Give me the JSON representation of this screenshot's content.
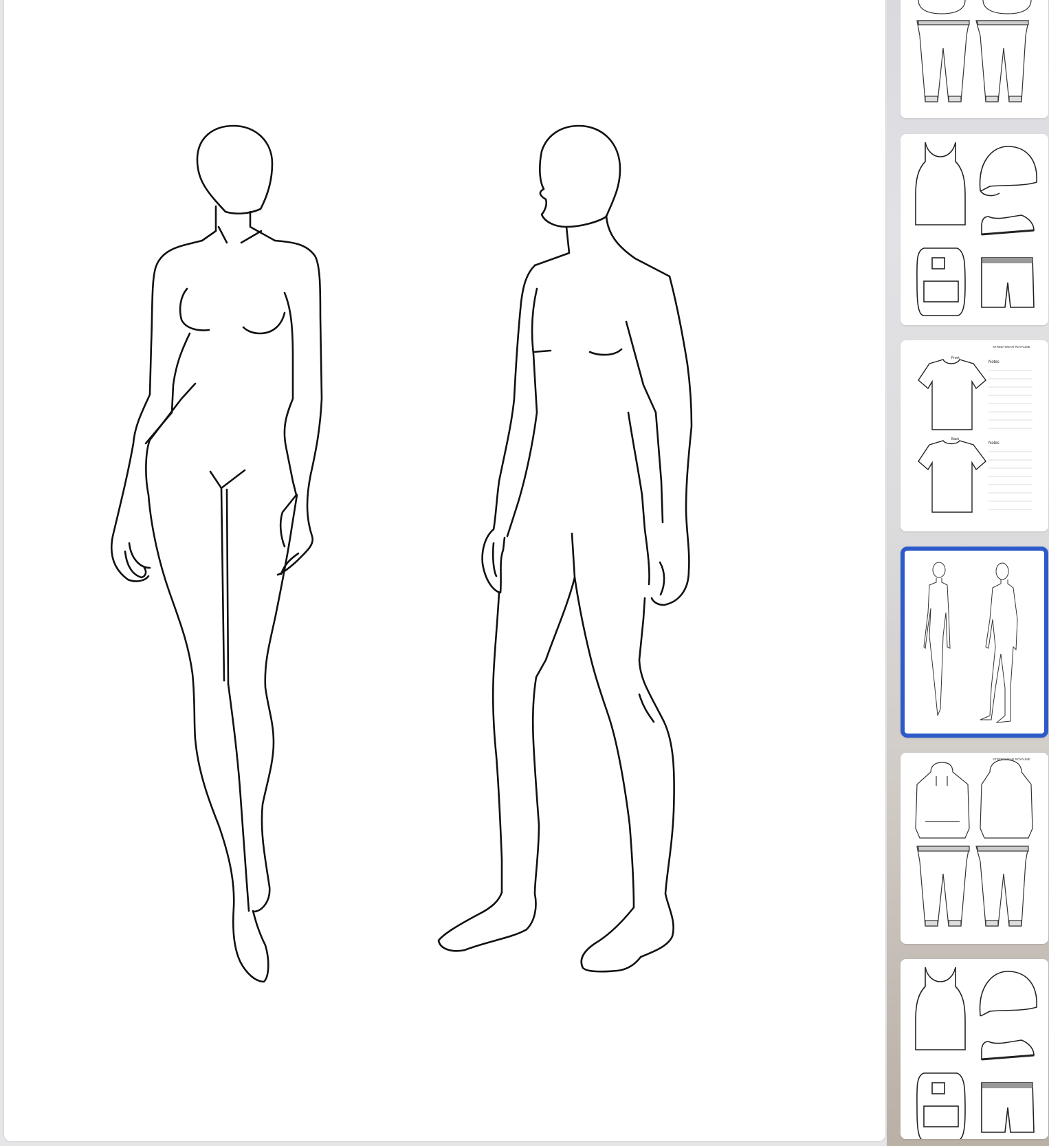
{
  "page_count": 6,
  "selected_page_index": 4,
  "selection_color": "#2c5ac9",
  "thumbnails": [
    {
      "name": "page-hoodie-sweatpants-partial",
      "icons": [
        "hoodie-icon",
        "sweatpants-icon"
      ]
    },
    {
      "name": "page-tank-cap-shoe-backpack-shorts",
      "icons": [
        "tank-top-icon",
        "cap-icon",
        "shoe-icon",
        "backpack-icon",
        "shorts-icon"
      ]
    },
    {
      "name": "page-tshirt-front-back-notes",
      "brand": "STREETWEAR ROYAUME",
      "front_label": "Front",
      "back_label": "Back",
      "notes_label_1": "Notes",
      "notes_label_2": "Notes"
    },
    {
      "name": "page-croquis-figures",
      "icons": [
        "female-croquis-icon",
        "male-croquis-icon"
      ]
    },
    {
      "name": "page-hoodie-sweatpants",
      "brand": "STREETWEAR ROYAUME",
      "icons": [
        "hoodie-icon",
        "sweatpants-icon"
      ]
    },
    {
      "name": "page-tank-cap-shoe-backpack-shorts-2",
      "icons": [
        "tank-top-icon",
        "cap-icon",
        "shoe-icon",
        "backpack-icon",
        "shorts-icon"
      ]
    }
  ]
}
